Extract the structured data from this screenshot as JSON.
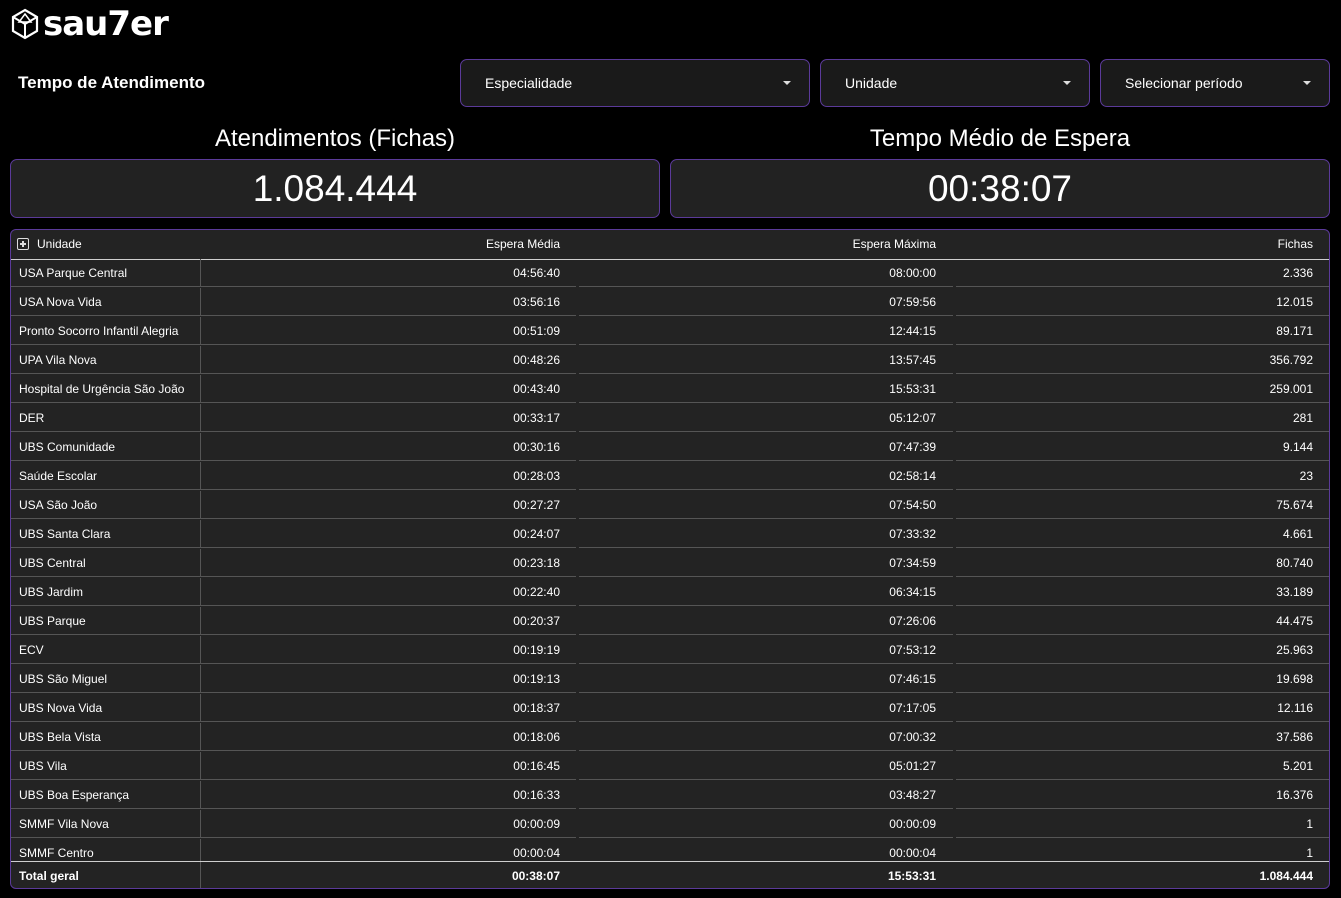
{
  "app": {
    "logo_text": "sau7er"
  },
  "page": {
    "title": "Tempo de Atendimento"
  },
  "filters": {
    "especialidade": "Especialidade",
    "unidade": "Unidade",
    "periodo": "Selecionar período"
  },
  "kpis": {
    "atendimentos_label": "Atendimentos (Fichas)",
    "atendimentos_value": "1.084.444",
    "tempo_label": "Tempo Médio de Espera",
    "tempo_value": "00:38:07"
  },
  "table": {
    "headers": {
      "unidade": "Unidade",
      "espera_media": "Espera Média",
      "espera_maxima": "Espera Máxima",
      "fichas": "Fichas"
    },
    "rows": [
      [
        "USA Parque Central",
        "04:56:40",
        "08:00:00",
        "2.336"
      ],
      [
        "USA Nova Vida",
        "03:56:16",
        "07:59:56",
        "12.015"
      ],
      [
        "Pronto Socorro Infantil Alegria",
        "00:51:09",
        "12:44:15",
        "89.171"
      ],
      [
        "UPA Vila Nova",
        "00:48:26",
        "13:57:45",
        "356.792"
      ],
      [
        "Hospital de Urgência São João",
        "00:43:40",
        "15:53:31",
        "259.001"
      ],
      [
        "DER",
        "00:33:17",
        "05:12:07",
        "281"
      ],
      [
        "UBS Comunidade",
        "00:30:16",
        "07:47:39",
        "9.144"
      ],
      [
        "Saúde Escolar",
        "00:28:03",
        "02:58:14",
        "23"
      ],
      [
        "USA São João",
        "00:27:27",
        "07:54:50",
        "75.674"
      ],
      [
        "UBS Santa Clara",
        "00:24:07",
        "07:33:32",
        "4.661"
      ],
      [
        "UBS Central",
        "00:23:18",
        "07:34:59",
        "80.740"
      ],
      [
        "UBS Jardim",
        "00:22:40",
        "06:34:15",
        "33.189"
      ],
      [
        "UBS Parque",
        "00:20:37",
        "07:26:06",
        "44.475"
      ],
      [
        "ECV",
        "00:19:19",
        "07:53:12",
        "25.963"
      ],
      [
        "UBS São Miguel",
        "00:19:13",
        "07:46:15",
        "19.698"
      ],
      [
        "UBS Nova Vida",
        "00:18:37",
        "07:17:05",
        "12.116"
      ],
      [
        "UBS Bela Vista",
        "00:18:06",
        "07:00:32",
        "37.586"
      ],
      [
        "UBS Vila",
        "00:16:45",
        "05:01:27",
        "5.201"
      ],
      [
        "UBS Boa Esperança",
        "00:16:33",
        "03:48:27",
        "16.376"
      ],
      [
        "SMMF Vila Nova",
        "00:00:09",
        "00:00:09",
        "1"
      ],
      [
        "SMMF Centro",
        "00:00:04",
        "00:00:04",
        "1"
      ]
    ],
    "total": [
      "Total geral",
      "00:38:07",
      "15:53:31",
      "1.084.444"
    ]
  },
  "colors": {
    "background": "#000000",
    "accent_border": "#5b3a99",
    "panel": "#232323"
  },
  "icons": {
    "logo": "dice-logo-icon",
    "dropdown": "caret-down-icon",
    "expand": "plus-square-icon"
  }
}
